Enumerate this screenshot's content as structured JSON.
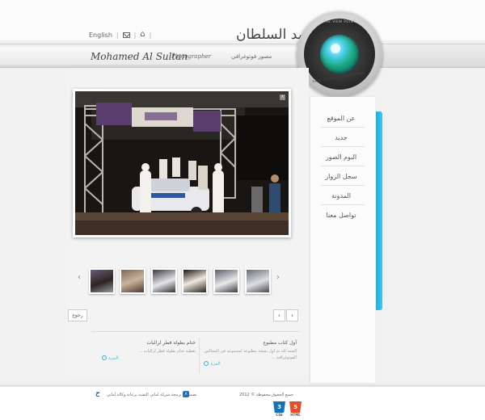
{
  "header": {
    "links": {
      "english": "English"
    },
    "name_ar": "محمد السلطان",
    "name_en": "Mohamed Al Sultan",
    "role_en": "Photographer",
    "role_ar": "مصور فوتوغرافي"
  },
  "logo": {
    "top_text": "THE VIEW POINT",
    "bottom_text": "f=18-55 mm  F 1:3.5-5.6 mm"
  },
  "nav": {
    "items": [
      {
        "label": "عن الموقع"
      },
      {
        "label": "جديد"
      },
      {
        "label": "البوم الصور"
      },
      {
        "label": "سجل الزوار"
      },
      {
        "label": "المدونة"
      },
      {
        "label": "تواصل معنا"
      }
    ]
  },
  "gallery": {
    "corner_label": "×",
    "prev_label": "‹",
    "next_label": "›",
    "thumbnail_count": 6,
    "pager_prev": "‹",
    "pager_next": "›",
    "back_label": "رجوع"
  },
  "news": {
    "right": {
      "title": "أول كتاب مطبوع",
      "body": "الحمد لله تم اول نسخة مطبوعة لمجموعه في المجالس الفوتوغرافية ...",
      "more": "المزيد"
    },
    "left": {
      "title": "ختام بطولة قطر لراليات",
      "body": "تغطية ختام بطولة قطر لراليات ...",
      "more": "المزيد"
    }
  },
  "footer": {
    "copyright": "جميع الحقوق محفوظة © 2012",
    "credits": "تصميم و برمجة شركة أماني التقنية  برعاية وكالة أماني",
    "badges": [
      {
        "name": "HTML",
        "num": "5",
        "color": "#e44d26"
      },
      {
        "name": "CSS",
        "num": "3",
        "color": "#1572b6"
      }
    ]
  },
  "colors": {
    "accent": "#27b7e0"
  }
}
